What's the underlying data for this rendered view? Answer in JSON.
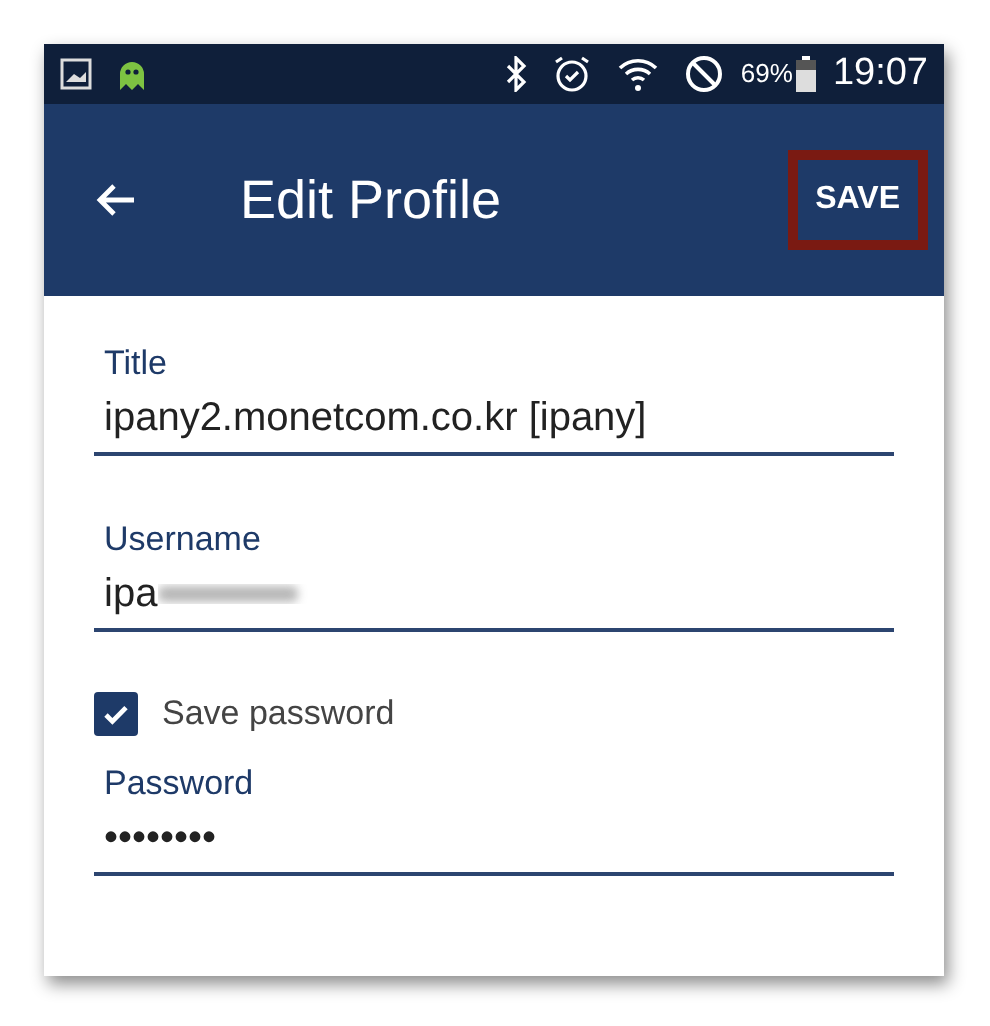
{
  "status_bar": {
    "battery": "69%",
    "time": "19:07"
  },
  "app_bar": {
    "title": "Edit Profile",
    "action": "SAVE",
    "action_highlighted": true
  },
  "fields": [
    {
      "kind": "text",
      "label": "Title",
      "value": "ipany2.monetcom.co.kr [ipany]"
    },
    {
      "kind": "redacted",
      "label": "Username",
      "value": "ipa"
    },
    {
      "kind": "checkbox",
      "label": "Save password",
      "checked": true
    },
    {
      "kind": "text",
      "label": "Password",
      "value": "••••••••"
    }
  ]
}
